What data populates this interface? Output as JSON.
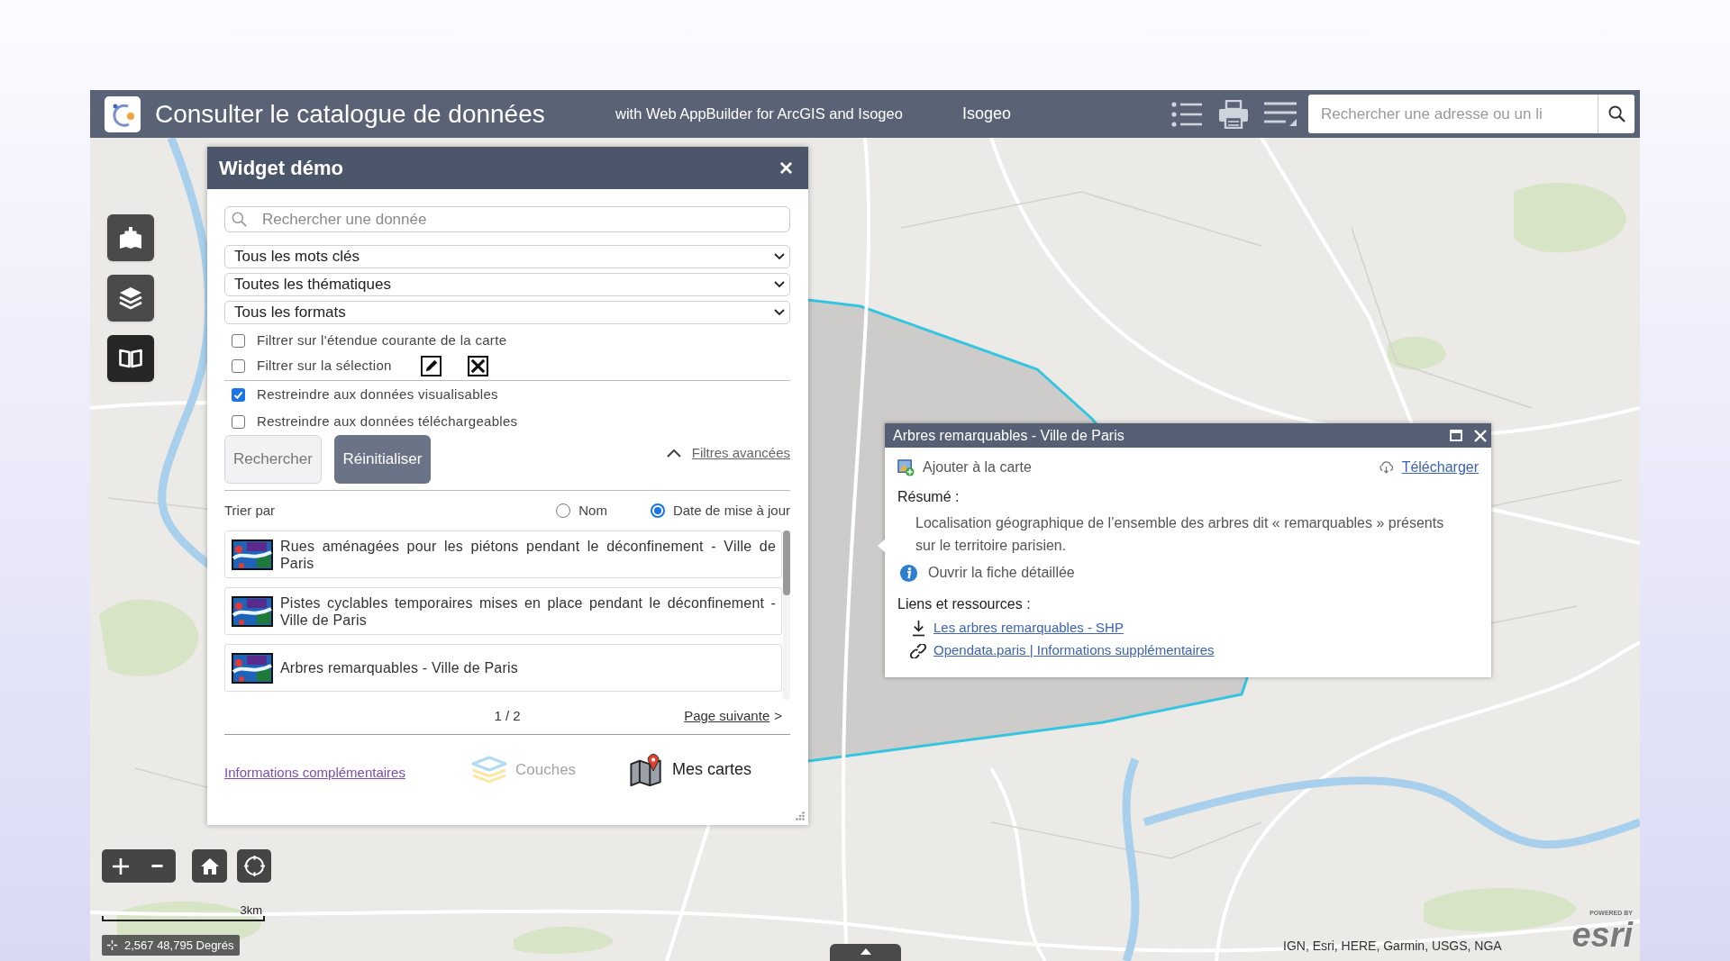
{
  "header": {
    "title": "Consulter le catalogue de données",
    "subtitle": "with Web AppBuilder for ArcGIS and Isogeo",
    "brand": "Isogeo",
    "search": {
      "placeholder": "Rechercher une adresse ou un li"
    }
  },
  "map_tools": [
    {
      "kind": "add",
      "selected": false
    },
    {
      "kind": "layers",
      "selected": false
    },
    {
      "kind": "catalog",
      "selected": true
    }
  ],
  "widget": {
    "title": "Widget démo",
    "search": {
      "placeholder": "Rechercher une donnée"
    },
    "dropdowns": [
      {
        "value": "Tous les mots clés"
      },
      {
        "value": "Toutes les thématiques"
      },
      {
        "value": "Tous les formats"
      }
    ],
    "filters": [
      {
        "kind": "plain",
        "label": "Filtrer sur l'étendue courante de la carte",
        "checked": false
      },
      {
        "kind": "selection",
        "label": "Filtrer sur la sélection",
        "checked": false
      }
    ],
    "restrictions": [
      {
        "label": "Restreindre aux données visualisables",
        "checked": true
      },
      {
        "label": "Restreindre aux données téléchargeables",
        "checked": false
      }
    ],
    "buttons": [
      {
        "kind": "secondary",
        "label": "Rechercher"
      },
      {
        "kind": "primary",
        "label": "Réinitialiser"
      }
    ],
    "advanced_filters": {
      "label": "Filtres avancées",
      "expanded": true
    },
    "sort": {
      "label": "Trier par",
      "options": [
        {
          "label": "Nom",
          "selected": false
        },
        {
          "label": "Date de mise à jour",
          "selected": true
        }
      ]
    },
    "results": [
      {
        "title": "Rues aménagées pour les piétons pendant le déconfinement - Ville de Paris"
      },
      {
        "title": "Pistes cyclables temporaires mises en place pendant le déconfinement - Ville de Paris"
      },
      {
        "title": "Arbres remarquables - Ville de Paris"
      }
    ],
    "pagination": {
      "page": "1 / 2",
      "next": "Page suivante",
      "next_arrow": ">"
    },
    "footer": {
      "info_link": "Informations complémentaires",
      "tabs": [
        {
          "kind": "layers",
          "label": "Couches",
          "disabled": true
        },
        {
          "kind": "maps",
          "label": "Mes cartes",
          "disabled": false
        }
      ]
    }
  },
  "popup": {
    "title": "Arbres remarquables - Ville de Paris",
    "add_to_map": "Ajouter à la carte",
    "download": "Télécharger",
    "summary_label": "Résumé :",
    "summary": "Localisation géographique de l’ensemble des arbres dit « remarquables » présents sur le territoire parisien.",
    "details_link": "Ouvrir la fiche détaillée",
    "resources_label": "Liens et ressources :",
    "resources": [
      {
        "kind": "download",
        "label": "Les arbres remarquables - SHP"
      },
      {
        "kind": "link",
        "label": "Opendata.paris | Informations supplémentaires"
      }
    ]
  },
  "map": {
    "scale": "3km",
    "coordinates": "2,567 48,795 Degrés",
    "attribution": "IGN, Esri, HERE, Garmin, USGS, NGA",
    "logo": {
      "tagline": "POWERED BY",
      "name": "esri"
    }
  }
}
